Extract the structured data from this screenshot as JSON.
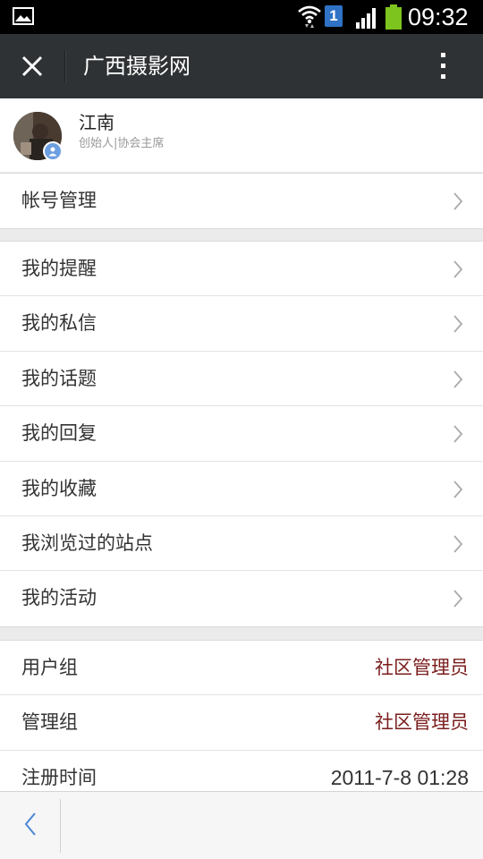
{
  "status_bar": {
    "time": "09:32",
    "sim_number": "1",
    "icons": [
      "gallery-icon",
      "wifi-icon",
      "signal-icon",
      "battery-icon"
    ],
    "battery_color": "#7dc41e"
  },
  "header": {
    "title": "广西摄影网",
    "close_icon": "close-icon",
    "more_icon": "more-vertical-icon",
    "background": "#2f3234"
  },
  "profile": {
    "name": "江南",
    "role": "创始人|协会主席"
  },
  "account_section": {
    "items": [
      {
        "label": "帐号管理"
      }
    ]
  },
  "menu_section": {
    "items": [
      {
        "label": "我的提醒"
      },
      {
        "label": "我的私信"
      },
      {
        "label": "我的话题"
      },
      {
        "label": "我的回复"
      },
      {
        "label": "我的收藏"
      },
      {
        "label": "我浏览过的站点"
      },
      {
        "label": "我的活动"
      }
    ]
  },
  "info_section": {
    "items": [
      {
        "label": "用户组",
        "value": "社区管理员"
      },
      {
        "label": "管理组",
        "value": "社区管理员"
      },
      {
        "label": "注册时间",
        "value": "2011-7-8 01:28"
      }
    ],
    "accent_color": "#7a1c1c"
  },
  "bottom_bar": {
    "back_icon": "chevron-left-icon",
    "icon_color": "#4a86d8"
  }
}
